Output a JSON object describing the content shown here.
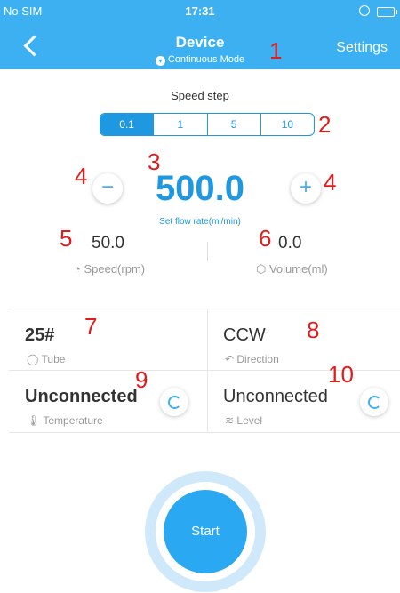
{
  "status_bar": {
    "carrier": "No SIM",
    "time": "17:31"
  },
  "header": {
    "title": "Device",
    "mode": "Continuous Mode",
    "settings_label": "Settings"
  },
  "speed_step": {
    "label": "Speed step",
    "options": [
      "0.1",
      "1",
      "5",
      "10"
    ],
    "selected": "0.1"
  },
  "flow": {
    "value": "500.0",
    "label": "Set flow rate(ml/min)",
    "minus": "−",
    "plus": "+"
  },
  "speed": {
    "value": "50.0",
    "label": "Speed(rpm)"
  },
  "volume": {
    "value": "0.0",
    "label": "Volume(ml)"
  },
  "tube": {
    "value": "25#",
    "label": "Tube"
  },
  "direction": {
    "value": "CCW",
    "label": "Direction"
  },
  "temperature": {
    "value": "Unconnected",
    "label": "Temperature"
  },
  "level": {
    "value": "Unconnected",
    "label": "Level"
  },
  "start_label": "Start",
  "annotations": [
    "1",
    "2",
    "3",
    "4",
    "4",
    "5",
    "6",
    "7",
    "8",
    "9",
    "10"
  ],
  "colors": {
    "header": "#3cb0f0",
    "accent": "#1e98e0",
    "annotation": "#e21b1b"
  }
}
